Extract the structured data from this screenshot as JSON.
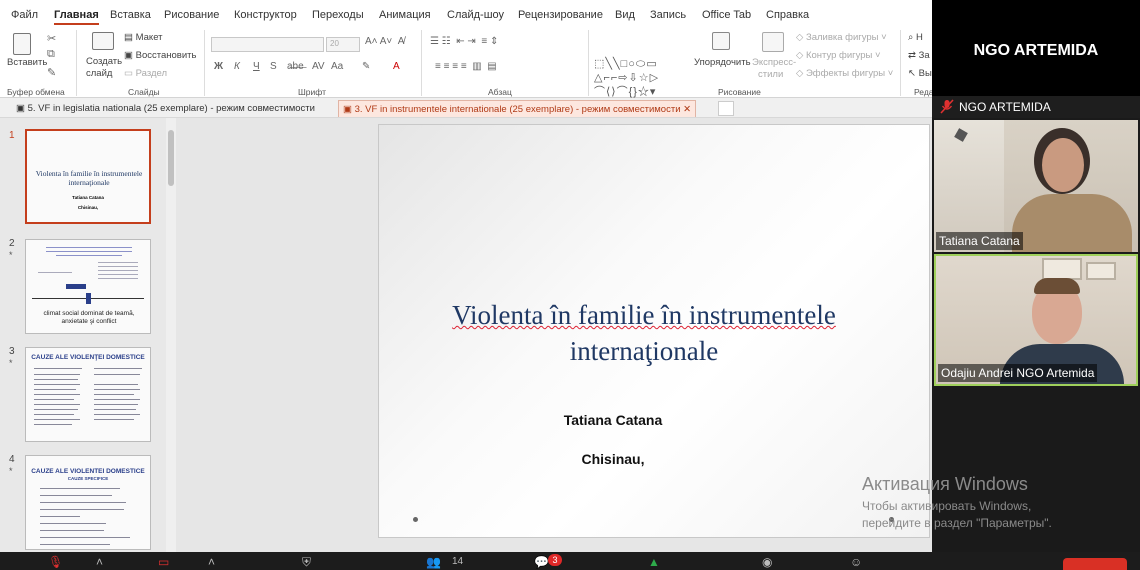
{
  "menu": [
    "Файл",
    "Главная",
    "Вставка",
    "Рисование",
    "Конструктор",
    "Переходы",
    "Анимация",
    "Слайд-шоу",
    "Рецензирование",
    "Вид",
    "Запись",
    "Office Tab",
    "Справка"
  ],
  "ribbon": {
    "paste": "Вставить",
    "new_slide_l1": "Создать",
    "new_slide_l2": "слайд",
    "layout": "Макет",
    "reset": "Восстановить",
    "section": "Раздел",
    "arrange": "Упорядочить",
    "express_l1": "Экспресс-",
    "express_l2": "стили",
    "fill": "Заливка фигуры",
    "outline": "Контур фигуры",
    "effects": "Эффекты фигуры",
    "edit_1": "Н",
    "edit_2": "За",
    "edit_3": "Вы",
    "font_size": "20",
    "groups": {
      "clipboard": "Буфер обмена",
      "slides": "Слайды",
      "font": "Шрифт",
      "paragraph": "Абзац",
      "drawing": "Рисование",
      "editing": "Реда"
    }
  },
  "tabs": [
    {
      "label": "5. VF in legislatia nationala (25 exemplare)  -  режим совместимости"
    },
    {
      "label": "3. VF in instrumentele internationale (25 exemplare)  -  режим совместимости"
    }
  ],
  "thumbnails": [
    {
      "num": "1",
      "title": "Violenta în familie în instrumentele internaţionale",
      "author": "Tatiana Catana",
      "city": "Chisinau,"
    },
    {
      "num": "2",
      "star": "*",
      "caption": "climat social dominat de teamă, anxietate şi conflict"
    },
    {
      "num": "3",
      "star": "*",
      "title": "CAUZE ALE VIOLENŢEI DOMESTICE"
    },
    {
      "num": "4",
      "star": "*",
      "title": "CAUZE ALE VIOLENTEI DOMESTICE",
      "sub": "CAUZE SPECIFICE"
    }
  ],
  "slide": {
    "title_line1": "Violenta în familie în instrumentele",
    "title_line2": "internaţionale",
    "author": "Tatiana Catana",
    "city": "Chisinau,"
  },
  "zoom": {
    "meeting_title": "NGO ARTEMIDA",
    "active_speaker": "NGO ARTEMIDA",
    "participants": [
      {
        "name": "Tatiana Catana"
      },
      {
        "name": "Odajiu Andrei NGO Artemida"
      }
    ],
    "participant_count": "14",
    "chat_badge": "3"
  },
  "watermark": {
    "line1": "Активация Windows",
    "line2": "Чтобы активировать Windows,",
    "line3": "перейдите в раздел \"Параметры\"."
  },
  "colors": {
    "accent": "#c43e1c",
    "slide_title": "#1f3864",
    "active_tile_border": "#9fd05b"
  }
}
